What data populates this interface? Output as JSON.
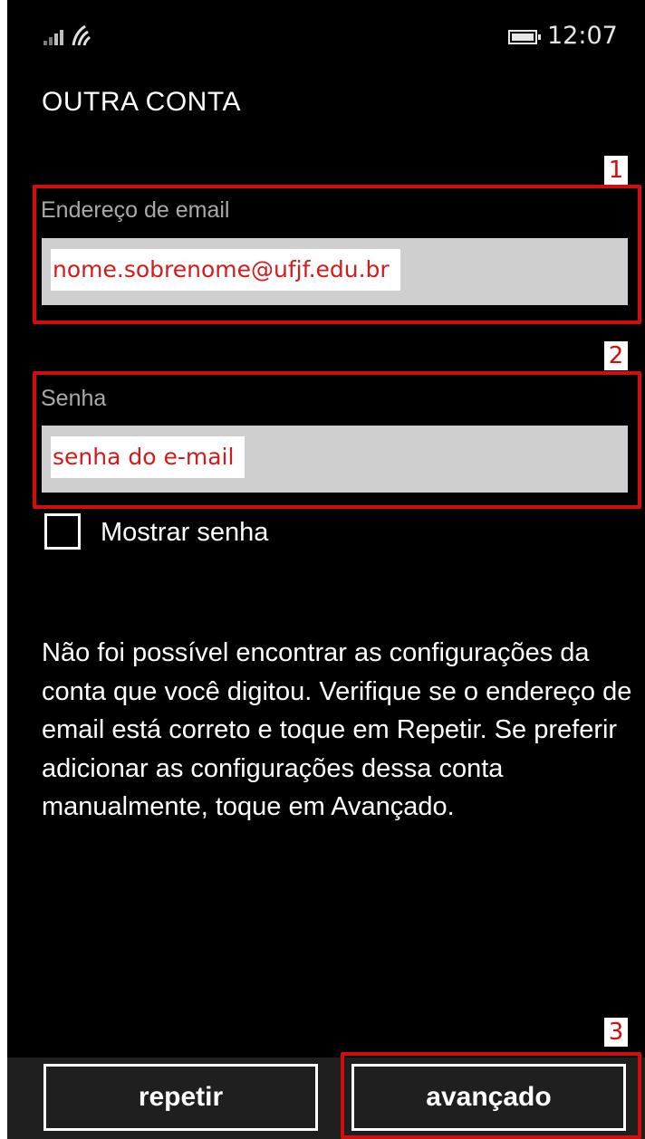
{
  "status_bar": {
    "time": "12:07",
    "icons": [
      "signal-strength-icon",
      "wifi-icon",
      "battery-icon"
    ]
  },
  "page": {
    "title": "OUTRA CONTA"
  },
  "email": {
    "label": "Endereço de email",
    "value": "nome.sobrenome@ufjf.edu.br"
  },
  "password": {
    "label": "Senha",
    "value": "senha do e-mail"
  },
  "show_password": {
    "label": "Mostrar senha",
    "checked": false
  },
  "message": "Não foi possível encontrar as configurações da conta que você digitou. Verifique se o endereço de email está correto e toque em Repetir. Se preferir adicionar as configurações dessa conta manualmente, toque em Avançado.",
  "buttons": {
    "retry": "repetir",
    "advanced": "avançado"
  },
  "annotations": {
    "email_marker": "1",
    "password_marker": "2",
    "advanced_marker": "3"
  },
  "colors": {
    "background": "#000000",
    "accent_annotation": "#d20d0d",
    "input_background": "#cfcfcf",
    "app_bar": "#1f1f1f"
  }
}
